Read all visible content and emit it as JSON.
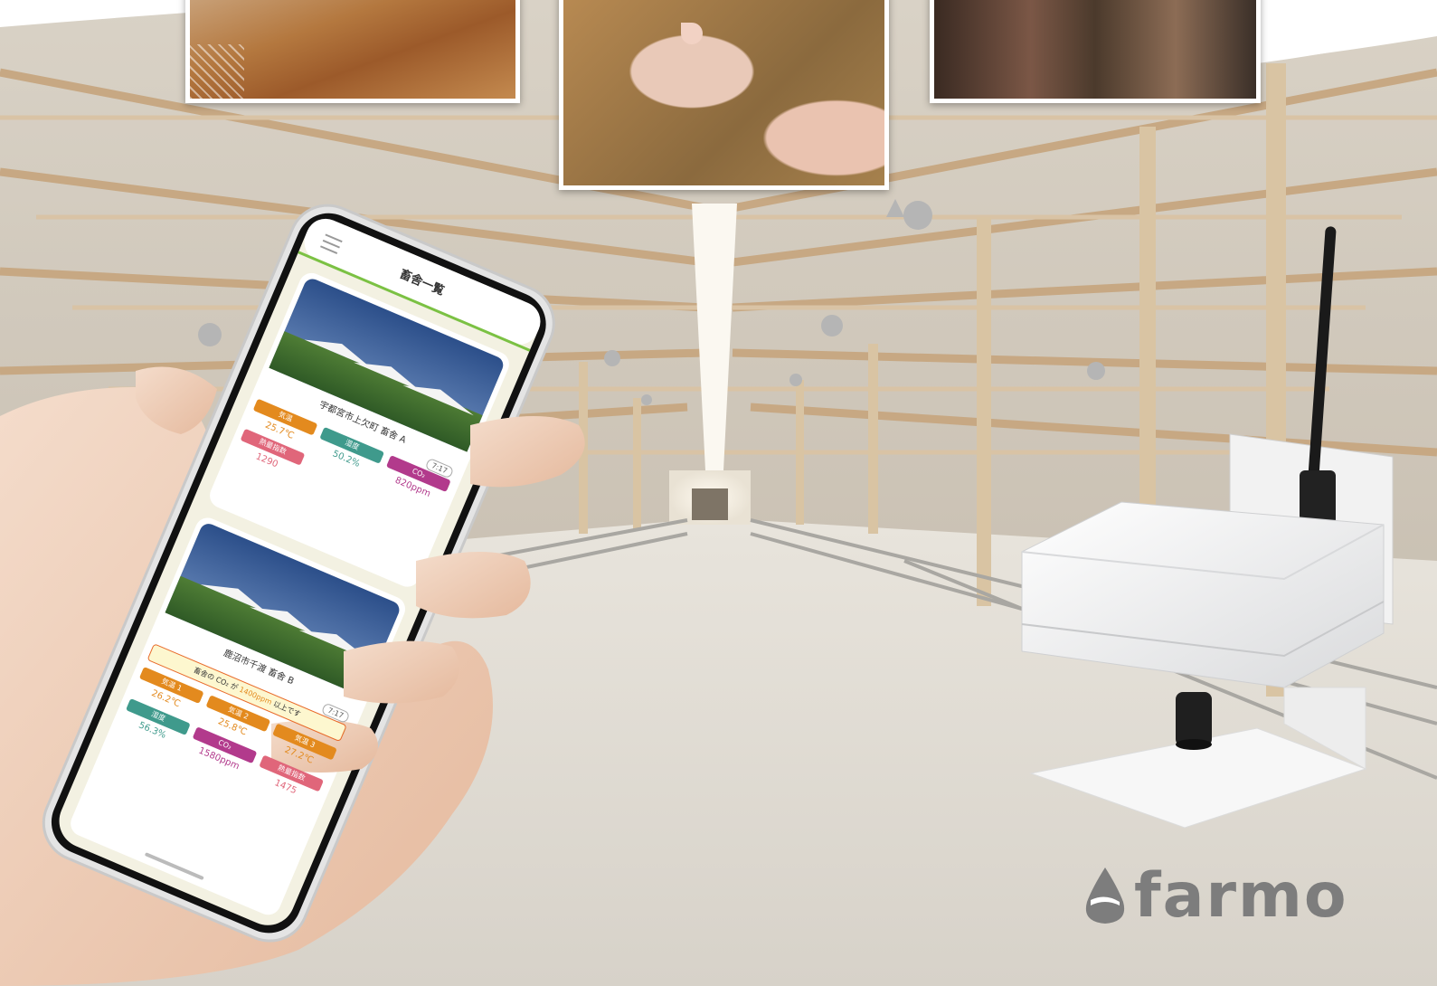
{
  "app": {
    "list_title": "畜舎一覧"
  },
  "barns": [
    {
      "name": "宇都宮市上欠町 畜舎 A",
      "time": "7:17",
      "alert": "",
      "metrics": [
        {
          "label": "気温",
          "value": "25.7℃",
          "color": "#e38a1e"
        },
        {
          "label": "湿度",
          "value": "50.2%",
          "color": "#3f9a8c"
        },
        {
          "label": "CO₂",
          "value": "820ppm",
          "color": "#b23a8c"
        },
        {
          "label": "熱量指数",
          "value": "1290",
          "color": "#e0667a"
        }
      ]
    },
    {
      "name": "鹿沼市千渡 畜舎 B",
      "time": "7:17",
      "alert_parts": {
        "prefix": "畜舎の CO₂ が",
        "value": "1400ppm",
        "suffix": "以上です"
      },
      "metrics": [
        {
          "label": "気温 1",
          "value": "26.2℃",
          "color": "#e38a1e"
        },
        {
          "label": "気温 2",
          "value": "25.8℃",
          "color": "#e38a1e"
        },
        {
          "label": "気温 3",
          "value": "27.2℃",
          "color": "#e38a1e"
        },
        {
          "label": "湿度",
          "value": "56.3%",
          "color": "#3f9a8c"
        },
        {
          "label": "CO₂",
          "value": "1580ppm",
          "color": "#b23a8c"
        },
        {
          "label": "熱量指数",
          "value": "1475",
          "color": "#e0667a"
        }
      ]
    }
  ],
  "brand": {
    "name": "farmo",
    "color": "#7d7d7d"
  },
  "colors": {
    "temperature": "#e38a1e",
    "humidity": "#3f9a8c",
    "co2": "#b23a8c",
    "heat_index": "#e0667a",
    "accent": "#7bc143"
  }
}
